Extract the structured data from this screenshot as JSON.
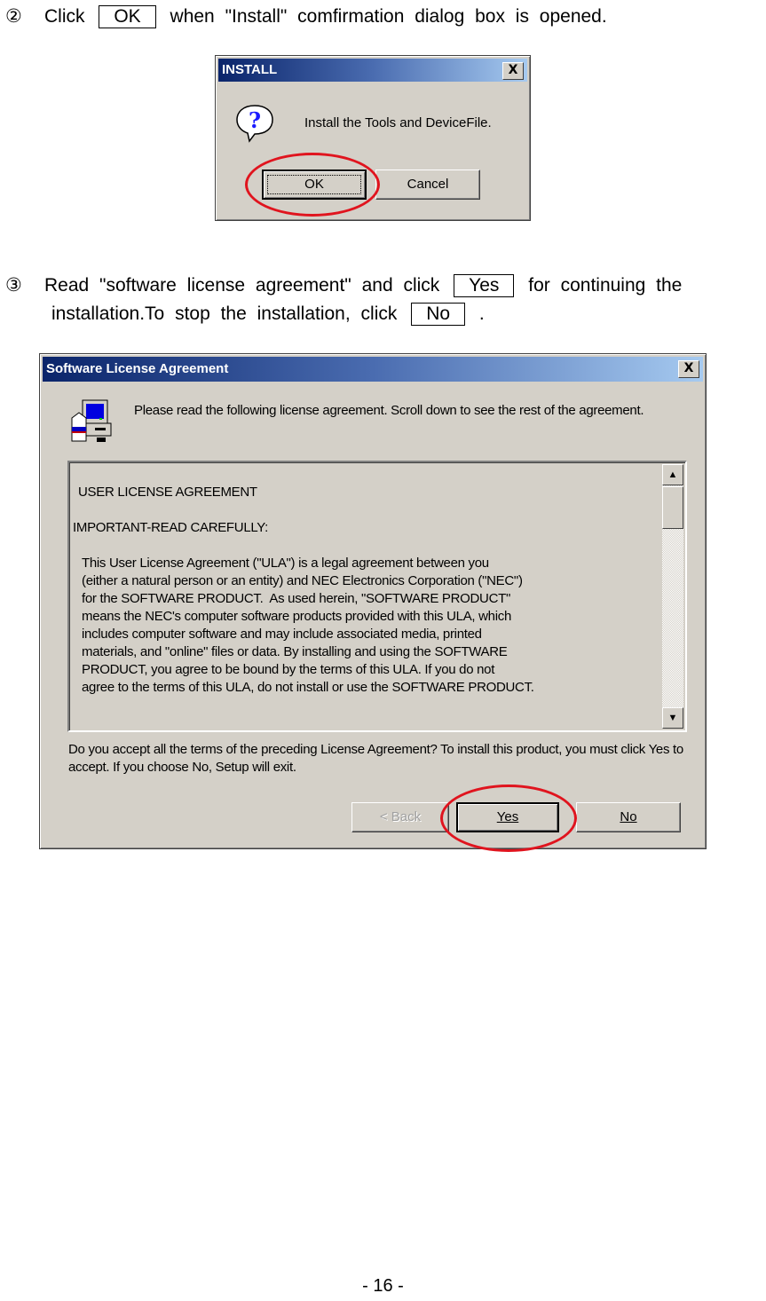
{
  "step2": {
    "marker": "②",
    "text_before": "Click",
    "button_label": "OK",
    "text_after": "when \"Install\" comfirmation dialog box is opened."
  },
  "install_dialog": {
    "title": "INSTALL",
    "close_label": "X",
    "icon": "question-icon",
    "message": "Install the Tools and DeviceFile.",
    "ok_label": "OK",
    "cancel_label": "Cancel"
  },
  "step3": {
    "marker": "③",
    "text_before": "Read \"software license agreement\" and click",
    "yes_label": "Yes",
    "text_middle": "for continuing the",
    "line2_before": "installation.To stop the installation, click",
    "no_label": "No",
    "line2_after": "."
  },
  "license_dialog": {
    "title": "Software License Agreement",
    "close_label": "X",
    "icon": "setup-computer-icon",
    "intro": "Please read the following license agreement. Scroll down to see the rest of the agreement.",
    "heading": "USER LICENSE AGREEMENT",
    "subheading": "IMPORTANT-READ CAREFULLY:",
    "body_lines": [
      "This User License Agreement (\"ULA\") is a legal agreement between you",
      "(either a natural person or an entity) and NEC Electronics Corporation (\"NEC\")",
      "for the SOFTWARE PRODUCT.  As used herein, \"SOFTWARE PRODUCT\"",
      "means the NEC's computer software products provided with this ULA, which",
      "includes computer software and may include associated media, printed",
      "materials, and \"online\" files or data. By installing and using the SOFTWARE",
      "PRODUCT, you agree to be bound by the terms of this ULA. If you do not",
      "agree to the terms of this ULA, do not install or use the SOFTWARE PRODUCT."
    ],
    "question": "Do you accept all the terms of the preceding License Agreement? To install this product, you must click Yes to accept. If you choose No, Setup will exit.",
    "back_label": "< Back",
    "yes_label": "Yes",
    "no_label": "No",
    "scroll_up": "▲",
    "scroll_down": "▼"
  },
  "footer": {
    "page": "- 16 -"
  },
  "colors": {
    "highlight_circle": "#e0141e",
    "dialog_face": "#d4d0c8",
    "title_dark": "#0a246a",
    "title_light": "#a6caf0"
  }
}
